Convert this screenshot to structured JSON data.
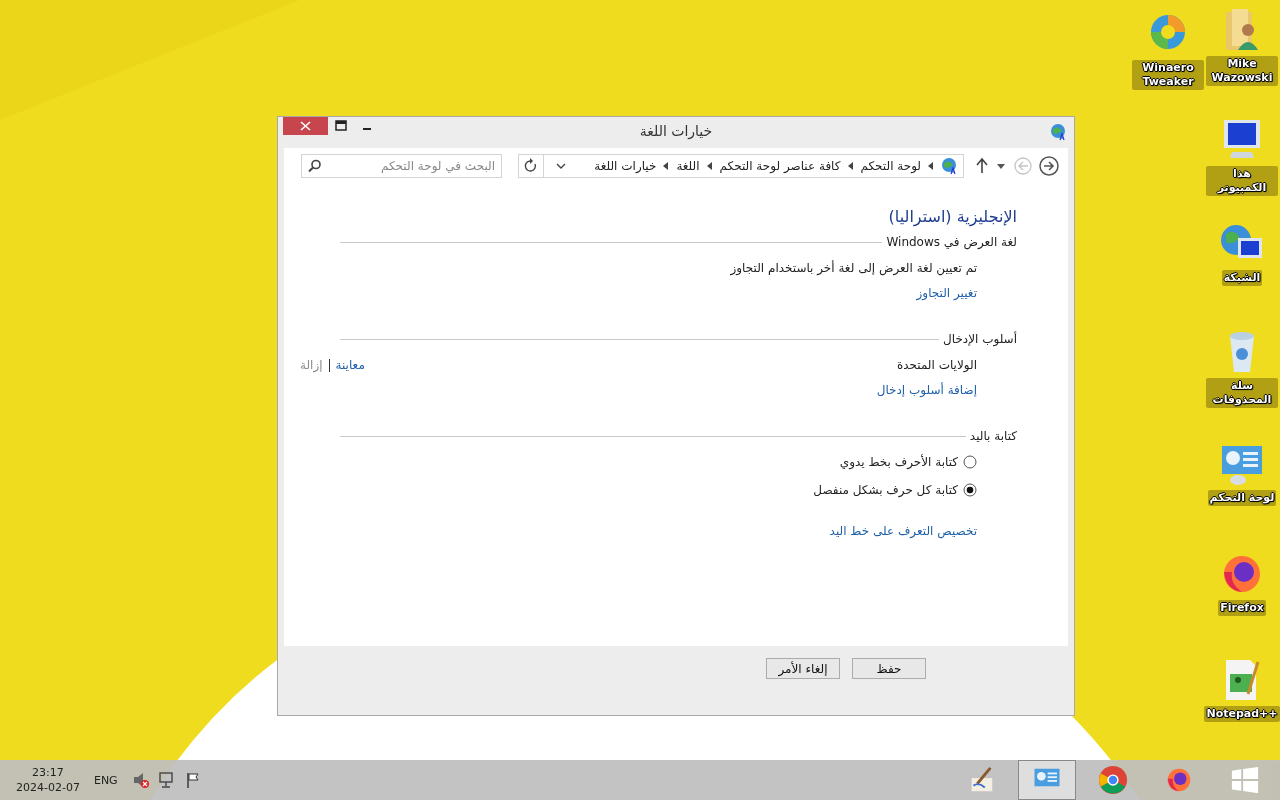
{
  "window": {
    "title": "خيارات اللغة"
  },
  "address_bar": {
    "back_disabled": true,
    "breadcrumbs": [
      "لوحة التحكم",
      "كافة عناصر لوحة التحكم",
      "اللغة",
      "خيارات اللغة"
    ]
  },
  "search": {
    "placeholder": "البحث في لوحة التحكم"
  },
  "content": {
    "heading": "الإنجليزية (استراليا)",
    "sections": [
      {
        "title": "لغة العرض في Windows",
        "items": [
          {
            "kind": "text",
            "text": "تم تعيين لغة العرض إلى لغة أخر باستخدام التجاوز"
          },
          {
            "kind": "link",
            "text": "تغيير التجاوز"
          }
        ]
      },
      {
        "title": "أسلوب الإدخال",
        "items": [
          {
            "kind": "method",
            "text": "الولايات المتحدة",
            "actions": [
              {
                "text": "معاينة",
                "disabled": false
              },
              {
                "text": "إزالة",
                "disabled": true
              }
            ]
          },
          {
            "kind": "link",
            "text": "إضافة أسلوب إدخال"
          }
        ]
      },
      {
        "title": "كتابة باليد",
        "items": [
          {
            "kind": "radio",
            "text": "كتابة الأحرف بخط يدوي",
            "selected": false
          },
          {
            "kind": "radio",
            "text": "كتابة كل حرف بشكل منفصل",
            "selected": true
          },
          {
            "kind": "link",
            "text": "تخصيص التعرف على خط اليد"
          }
        ]
      }
    ]
  },
  "buttons": [
    {
      "label": "حفظ"
    },
    {
      "label": "إلغاء الأمر"
    }
  ],
  "desktop_icons": [
    {
      "kind": "user-folder",
      "label": "Mike Wazowski"
    },
    {
      "kind": "computer",
      "label": "هذا الكمبيوتر"
    },
    {
      "kind": "network",
      "label": "الشبكة"
    },
    {
      "kind": "recycle",
      "label": "سلة المحذوفات"
    },
    {
      "kind": "control-panel",
      "label": "لوحة التحكم"
    },
    {
      "kind": "firefox",
      "label": "Firefox"
    },
    {
      "kind": "notepad",
      "label": "Notepad++"
    },
    {
      "kind": "tweaker",
      "label": "Winaero Tweaker"
    }
  ],
  "taskbar": {
    "time": "23:17",
    "date": "2024-02-07",
    "language": "ENG",
    "apps": [
      {
        "kind": "start",
        "active": false
      },
      {
        "kind": "firefox",
        "active": false
      },
      {
        "kind": "chrome",
        "active": false
      },
      {
        "kind": "control-panel",
        "active": true
      },
      {
        "kind": "paint",
        "active": false
      }
    ]
  }
}
